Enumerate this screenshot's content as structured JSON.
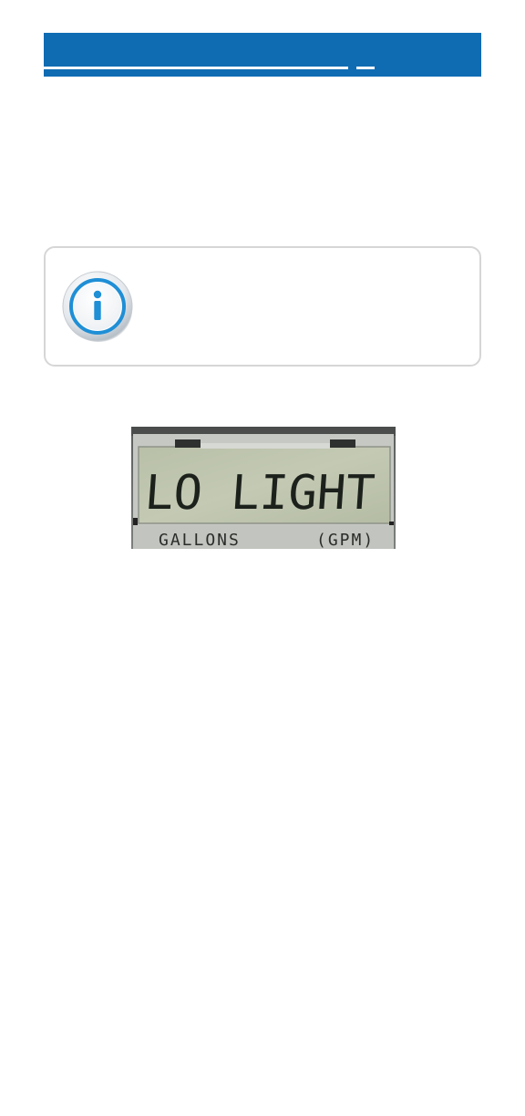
{
  "header": {
    "title": "",
    "accent_color": "#0f6cb3"
  },
  "note": {
    "icon": "info-icon",
    "text": ""
  },
  "lcd": {
    "display_text": "LO LIGHT",
    "label_left": "GALLONS",
    "label_right": "(GPM)"
  }
}
